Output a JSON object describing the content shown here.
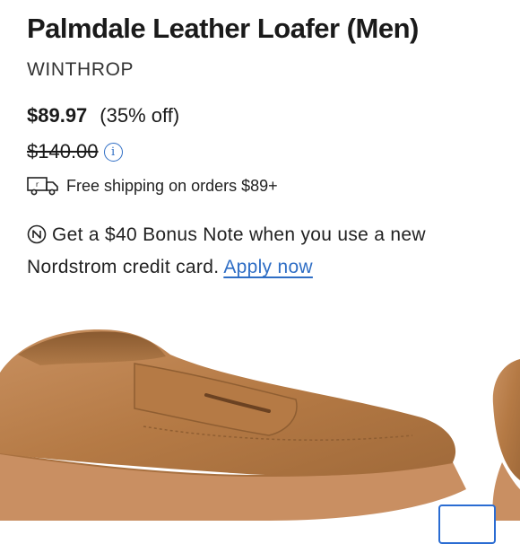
{
  "product": {
    "title": "Palmdale Leather Loafer (Men)",
    "brand": "WINTHROP"
  },
  "pricing": {
    "price": "$89.97",
    "discount": "(35% off)",
    "original_price": "$140.00"
  },
  "shipping": {
    "text": "Free shipping on orders $89+"
  },
  "promo": {
    "text": "Get a $40 Bonus Note when you use a new Nordstrom credit card.",
    "link_label": "Apply now"
  },
  "colors": {
    "link": "#2f6ec5",
    "shoe": "#b8804d",
    "sole": "#c98f62"
  },
  "icons": {
    "info": "info-icon",
    "shipping": "truck-icon",
    "promo": "nordstrom-note-icon"
  }
}
